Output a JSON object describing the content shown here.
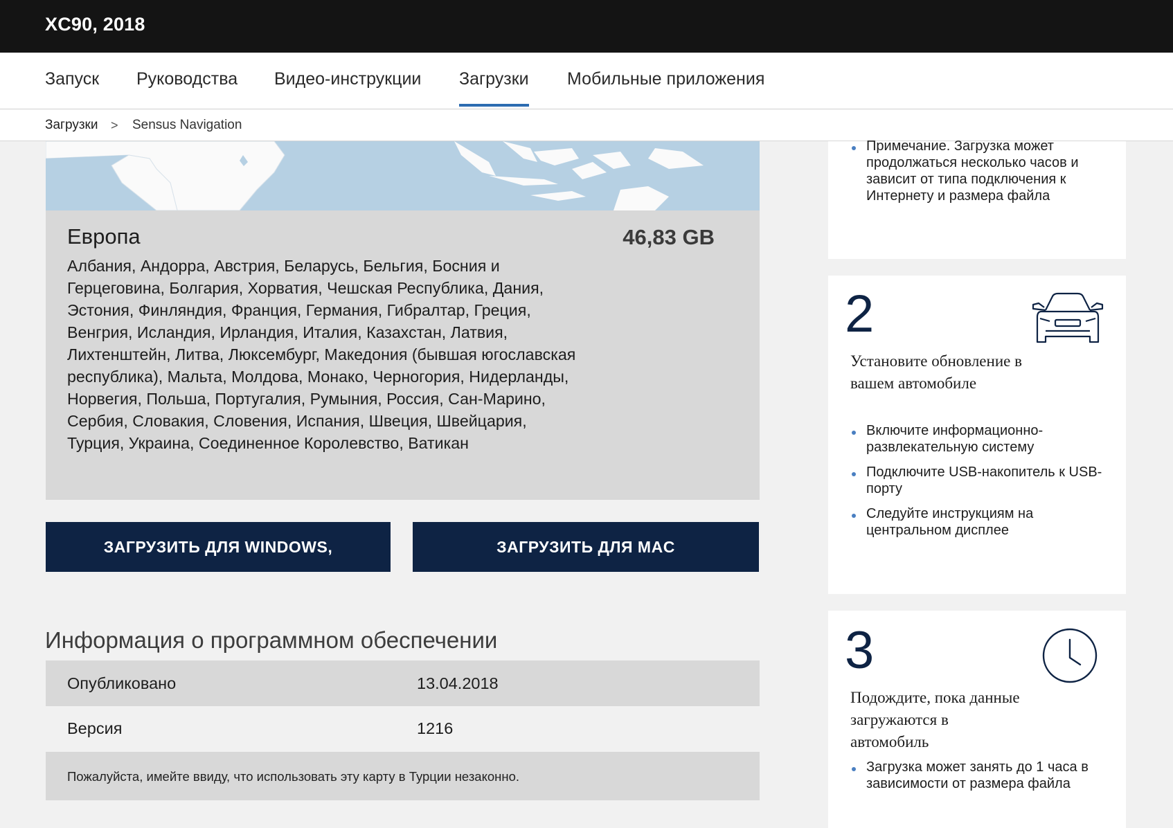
{
  "header": {
    "title": "XC90, 2018"
  },
  "nav": {
    "items": [
      {
        "label": "Запуск"
      },
      {
        "label": "Руководства"
      },
      {
        "label": "Видео-инструкции"
      },
      {
        "label": "Загрузки"
      },
      {
        "label": "Мобильные приложения"
      }
    ],
    "active": "Загрузки"
  },
  "breadcrumb": {
    "parent": "Загрузки",
    "separator": ">",
    "current": "Sensus Navigation"
  },
  "region": {
    "name": "Европа",
    "size": "46,83 GB",
    "countries": "Албания, Андорра, Австрия, Беларусь, Бельгия, Босния и Герцеговина, Болгария, Хорватия, Чешская Республика, Дания, Эстония, Финляндия, Франция, Германия, Гибралтар, Греция, Венгрия, Исландия, Ирландия, Италия, Казахстан, Латвия, Лихтенштейн, Литва, Люксембург, Македония (бывшая югославская республика), Мальта, Молдова, Монако, Черногория, Нидерланды, Норвегия, Польша, Португалия, Румыния, Россия, Сан-Марино, Сербия, Словакия, Словения, Испания, Швеция, Швейцария, Турция, Украина, Соединенное Королевство, Ватикан"
  },
  "buttons": {
    "windows": "ЗАГРУЗИТЬ ДЛЯ WINDOWS,",
    "mac": "ЗАГРУЗИТЬ ДЛЯ MAC"
  },
  "software": {
    "title": "Информация о программном обеспечении",
    "published_label": "Опубликовано",
    "published_value": "13.04.2018",
    "version_label": "Версия",
    "version_value": "1216",
    "note": "Пожалуйста, имейте ввиду, что использовать эту карту в Турции незаконно."
  },
  "steps": {
    "step1": {
      "bullets": [
        "Примечание. Загрузка может продолжаться несколько часов и зависит от типа подключения к Интернету и размера файла"
      ]
    },
    "step2": {
      "number": "2",
      "title": "Установите обновление в вашем автомобиле",
      "icon": "car-icon",
      "bullets": [
        "Включите информационно-развлекательную систему",
        "Подключите USB-накопитель к USB-порту",
        "Следуйте инструкциям на центральном дисплее"
      ]
    },
    "step3": {
      "number": "3",
      "title": "Подождите, пока данные загружаются в автомобиль",
      "icon": "clock-icon",
      "bullets": [
        "Загрузка может занять до 1 часа в зависимости от размера файла"
      ]
    }
  },
  "colors": {
    "header_bg": "#141414",
    "button_bg": "#0e2344",
    "accent": "#2d6cb1",
    "map_water": "#b6d0e3"
  }
}
